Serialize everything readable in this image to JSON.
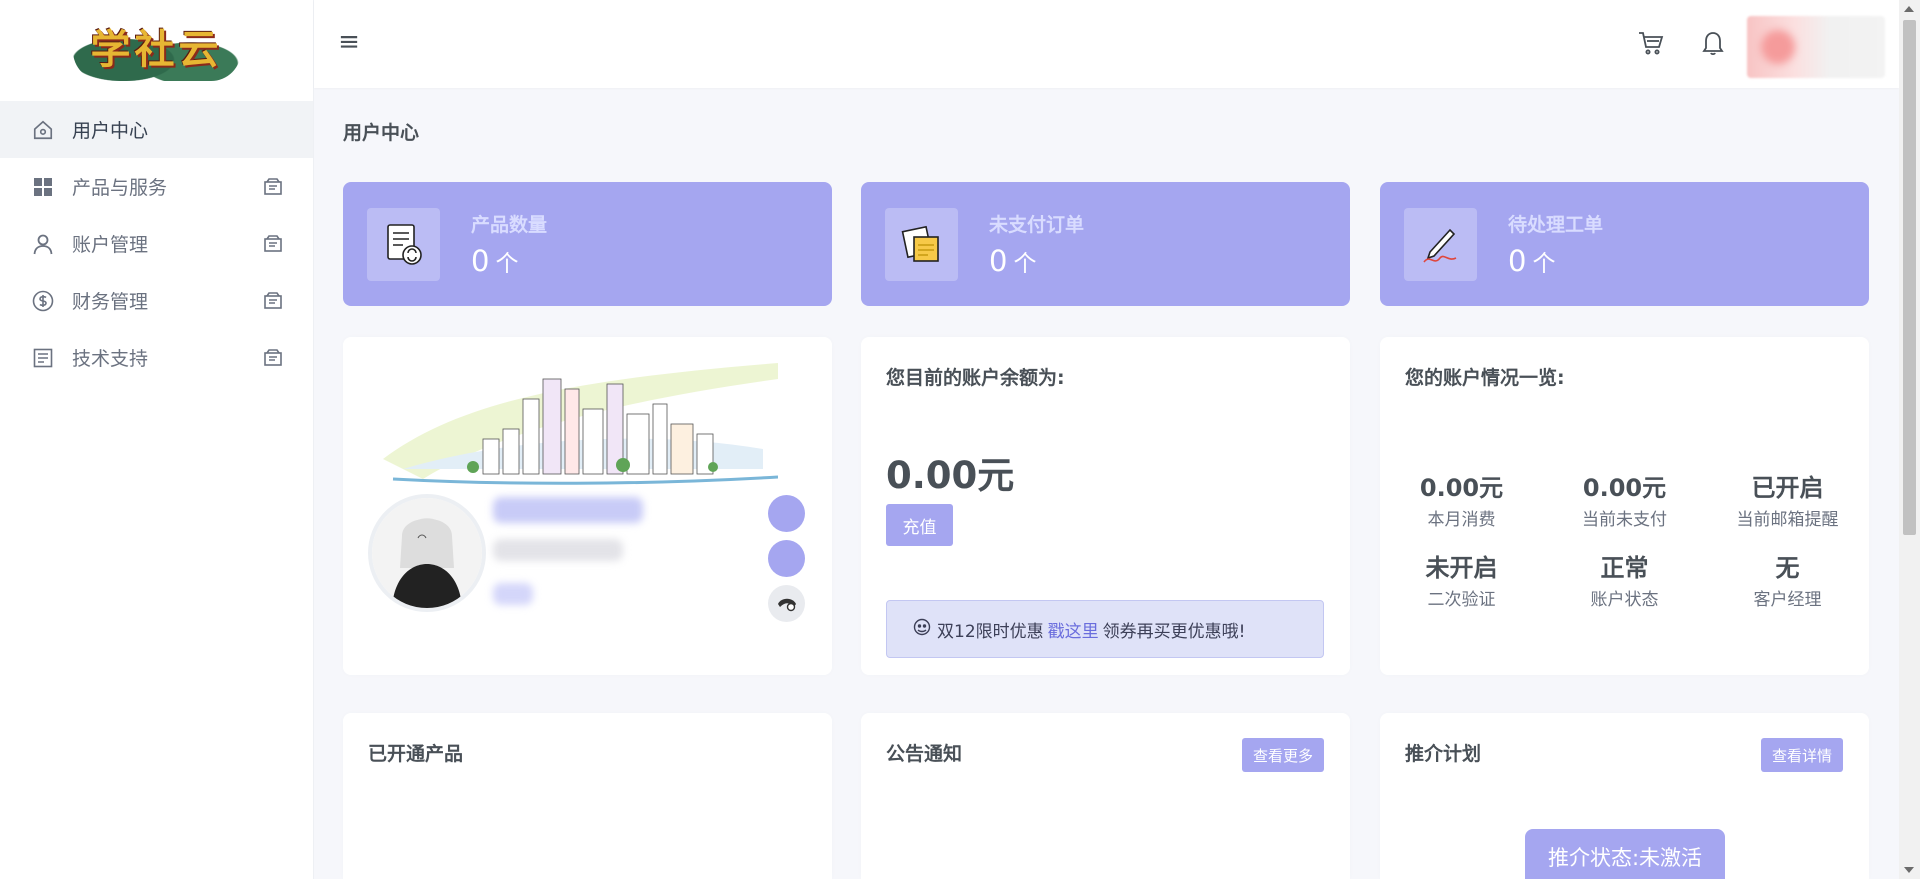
{
  "brand": {
    "logo_text": "学社云"
  },
  "sidebar": {
    "items": [
      {
        "label": "用户中心",
        "icon": "home-icon"
      },
      {
        "label": "产品与服务",
        "icon": "grid-icon"
      },
      {
        "label": "账户管理",
        "icon": "user-icon"
      },
      {
        "label": "财务管理",
        "icon": "dollar-icon"
      },
      {
        "label": "技术支持",
        "icon": "document-icon"
      }
    ]
  },
  "header": {
    "menu_icon": "≡"
  },
  "page": {
    "title": "用户中心"
  },
  "stats": [
    {
      "title": "产品数量",
      "value": "0",
      "unit": "个",
      "icon": "product-list-icon"
    },
    {
      "title": "未支付订单",
      "value": "0",
      "unit": "个",
      "icon": "sticky-note-icon"
    },
    {
      "title": "待处理工单",
      "value": "0",
      "unit": "个",
      "icon": "pen-signature-icon"
    }
  ],
  "balance": {
    "heading": "您目前的账户余额为:",
    "amount": "0.00元",
    "recharge_label": "充值",
    "promo_prefix": "双12限时优惠",
    "promo_link": "戳这里",
    "promo_suffix": "领券再买更优惠哦!"
  },
  "overview": {
    "heading": "您的账户情况一览:",
    "items": [
      {
        "value": "0.00元",
        "label": "本月消费"
      },
      {
        "value": "0.00元",
        "label": "当前未支付"
      },
      {
        "value": "已开启",
        "label": "当前邮箱提醒"
      },
      {
        "value": "未开启",
        "label": "二次验证"
      },
      {
        "value": "正常",
        "label": "账户状态"
      },
      {
        "value": "无",
        "label": "客户经理"
      }
    ]
  },
  "products": {
    "heading": "已开通产品"
  },
  "notices": {
    "heading": "公告通知",
    "more_label": "查看更多"
  },
  "referral": {
    "heading": "推介计划",
    "detail_label": "查看详情",
    "status": "推介状态:未激活"
  },
  "colors": {
    "accent": "#a5a6f0",
    "accent_text": "#d9dcff",
    "background": "#f6f7fb"
  }
}
